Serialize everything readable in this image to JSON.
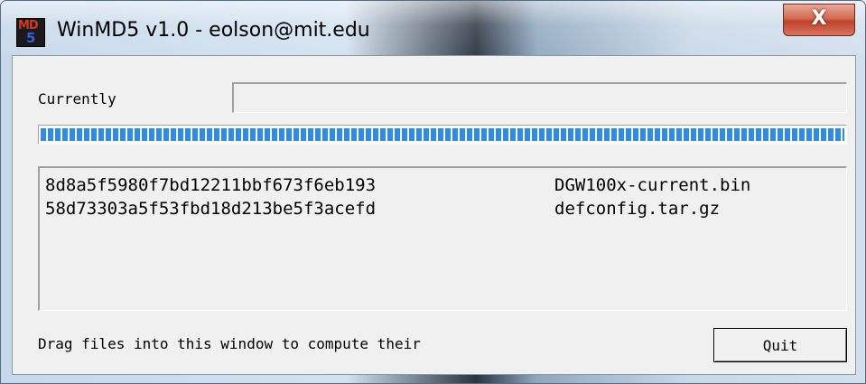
{
  "window": {
    "title": "WinMD5 v1.0 - eolson@mit.edu",
    "app_icon": "md5-app-icon",
    "close_glyph": "X"
  },
  "currently": {
    "label": "Currently",
    "value": ""
  },
  "progress": {
    "percent": 100,
    "color": "#2e8be8"
  },
  "results": [
    {
      "hash": "8d8a5f5980f7bd12211bbf673f6eb193",
      "file": "DGW100x-current.bin"
    },
    {
      "hash": "58d73303a5f53fbd18d213be5f3acefd",
      "file": "defconfig.tar.gz"
    }
  ],
  "hint": "Drag files into this window to compute their",
  "buttons": {
    "quit": "Quit"
  }
}
